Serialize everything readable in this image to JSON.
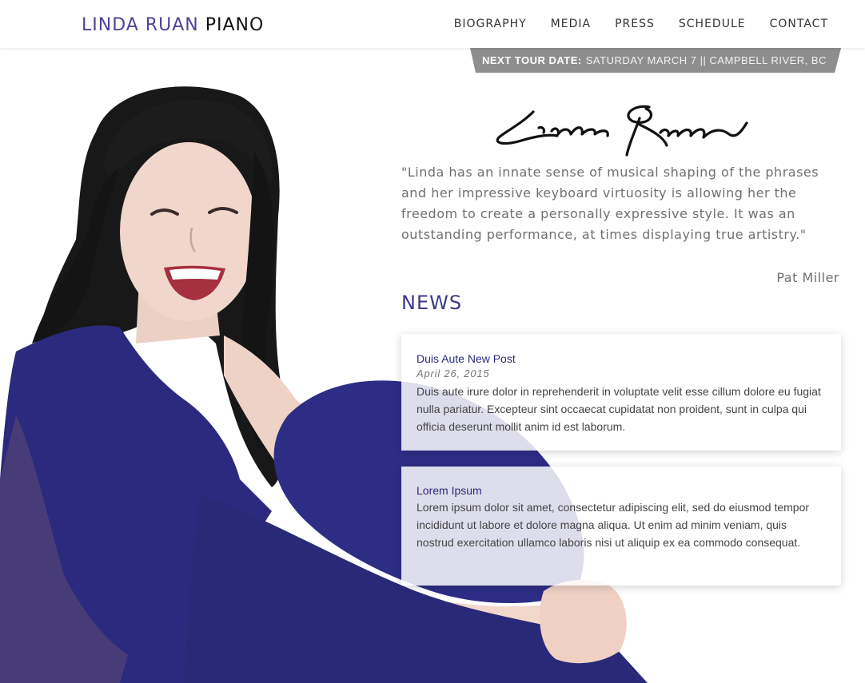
{
  "header": {
    "logo_name": "LINDA RUAN",
    "logo_word": "PIANO",
    "nav": [
      "BIOGRAPHY",
      "MEDIA",
      "PRESS",
      "SCHEDULE",
      "CONTACT"
    ]
  },
  "tour": {
    "label": "NEXT TOUR DATE:",
    "value": "SATURDAY MARCH 7 || CAMPBELL RIVER, BC"
  },
  "signature_text": "Linda Ruan",
  "quote": {
    "text": "\"Linda has an innate sense of musical shaping of the phrases and her impressive keyboard virtuosity is allowing her the freedom to create a personally expressive style. It was an outstanding performance, at times displaying true artistry.\"",
    "author": "Pat Miller"
  },
  "news": {
    "heading": "NEWS",
    "posts": [
      {
        "title": "Duis Aute New Post",
        "date": "April 26, 2015",
        "body": "Duis aute irure dolor in reprehenderit in voluptate velit esse cillum dolore eu fugiat nulla pariatur. Excepteur sint occaecat cupidatat non proident, sunt in culpa qui officia deserunt mollit anim id est laborum."
      },
      {
        "title": "Lorem Ipsum",
        "body": "Lorem ipsum dolor sit amet, consectetur adipiscing elit, sed do eiusmod tempor incididunt ut labore et dolore magna aliqua. Ut enim ad minim veniam, quis nostrud exercitation ullamco laboris nisi ut aliquip ex ea commodo consequat."
      }
    ]
  },
  "colors": {
    "accent": "#4a4597",
    "heading": "#3b3a86",
    "ribbon": "#8e8e8e",
    "dress": "#2b2a7e"
  }
}
